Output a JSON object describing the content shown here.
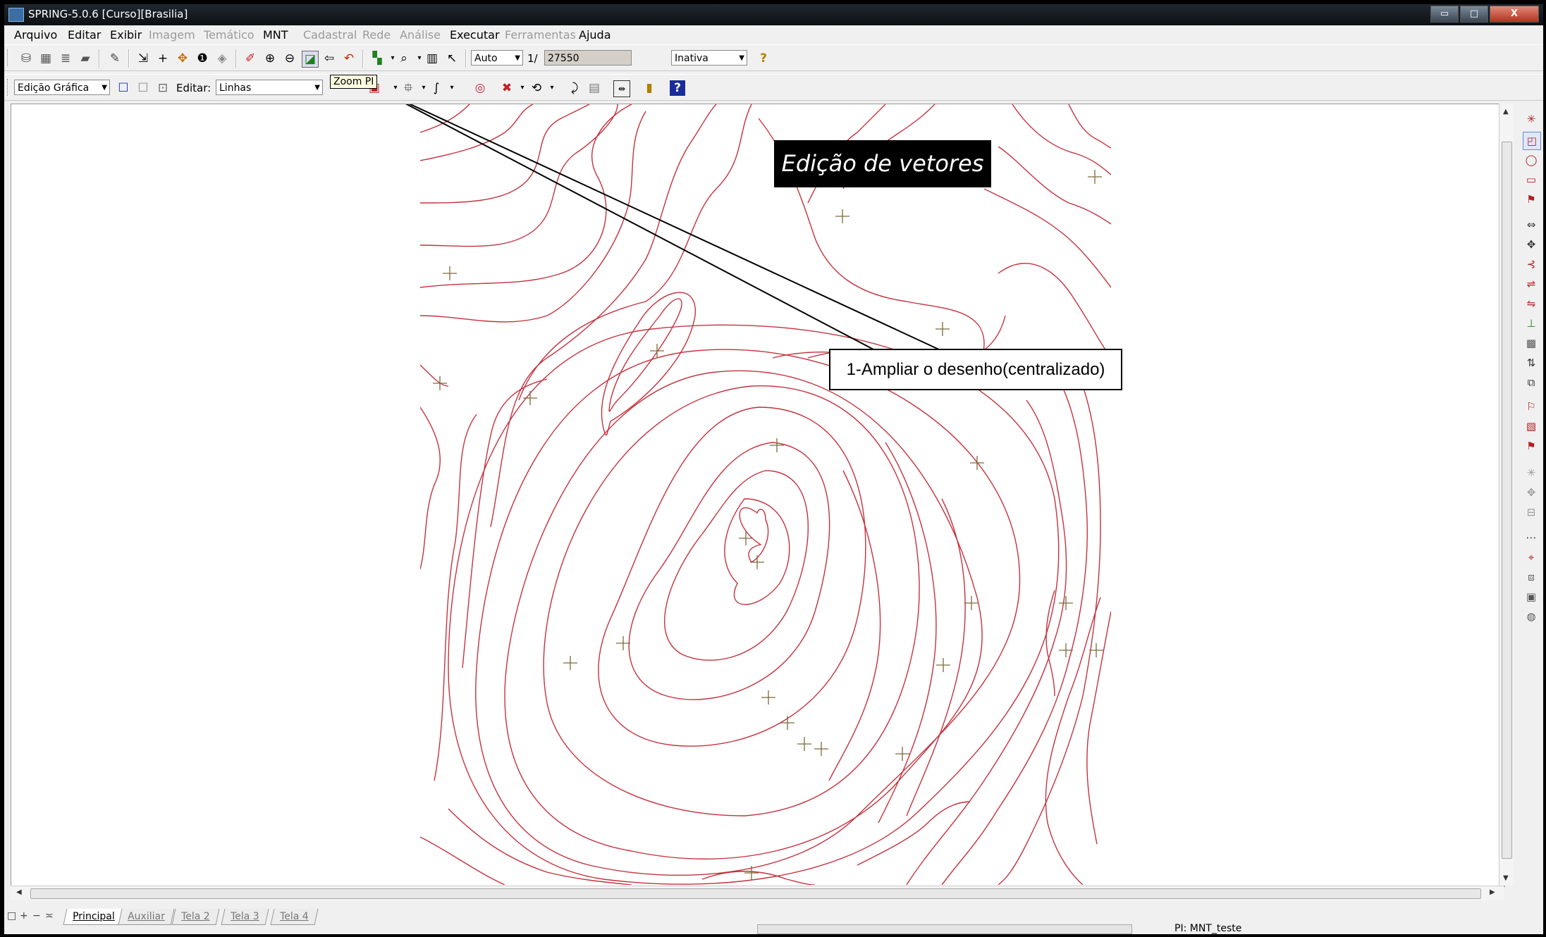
{
  "window": {
    "title": "SPRING-5.0.6 [Curso][Brasilia]",
    "minimize": "▭",
    "maximize": "□",
    "close": "X"
  },
  "menu": [
    {
      "label": "Arquivo",
      "enabled": true
    },
    {
      "label": "Editar",
      "enabled": true
    },
    {
      "label": "Exibir",
      "enabled": true
    },
    {
      "label": "Imagem",
      "enabled": false
    },
    {
      "label": "Temático",
      "enabled": false
    },
    {
      "label": "MNT",
      "enabled": true
    },
    {
      "label": "Cadastral",
      "enabled": false
    },
    {
      "label": "Rede",
      "enabled": false
    },
    {
      "label": "Análise",
      "enabled": false
    },
    {
      "label": "Executar",
      "enabled": true
    },
    {
      "label": "Ferramentas",
      "enabled": false
    },
    {
      "label": "Ajuda",
      "enabled": true
    }
  ],
  "toolbar1": {
    "scale_mode": "Auto",
    "scale_prefix": "1/",
    "scale_value": "27550",
    "status_combo": "Inativa",
    "help_icon": "?"
  },
  "toolbar2": {
    "mode_combo": "Edição Gráfica",
    "edit_label": "Editar:",
    "edit_combo": "Linhas",
    "tooltip": "Zoom PI"
  },
  "annotations": {
    "banner": "Edição de vetores",
    "callout": "1-Ampliar o desenho(centralizado)"
  },
  "tabs": {
    "controls": [
      "□",
      "+",
      "−",
      "≍"
    ],
    "items": [
      "Principal",
      "Auxiliar",
      "Tela 2",
      "Tela 3",
      "Tela 4"
    ],
    "active": "Principal"
  },
  "status": {
    "pi_label": "PI: MNT_teste"
  },
  "colors": {
    "contour": "#c4323e",
    "sample_point": "#7a6a3a",
    "banner_bg": "#000000"
  }
}
